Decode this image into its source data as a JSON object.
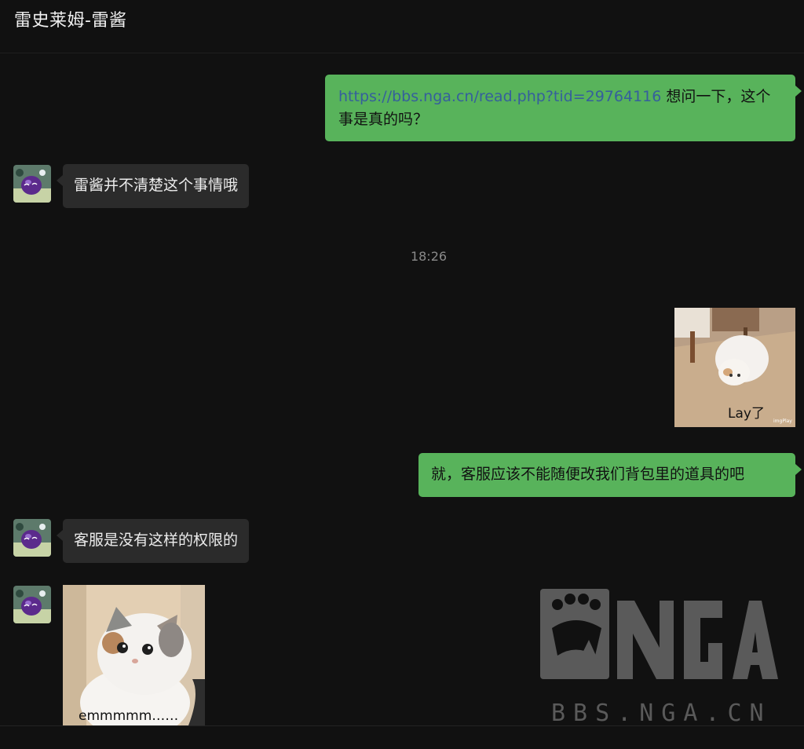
{
  "header": {
    "title": "雷史莱姆-雷酱"
  },
  "messages": {
    "m1": {
      "link": "https://bbs.nga.cn/read.php?tid=29764116",
      "text_line1": " 想问一下，这个",
      "text_line2": "事是真的吗？"
    },
    "m2": {
      "text": "雷酱并不清楚这个事情哦"
    },
    "time": "18:26",
    "m3": {
      "caption": "Lay了",
      "credit": "imgPlay"
    },
    "m4": {
      "text": "就，客服应该不能随便改我们背包里的道具的吧"
    },
    "m5": {
      "text": "客服是没有这样的权限的"
    },
    "m6": {
      "caption": "emmmmm……"
    }
  },
  "watermark": {
    "text": "BBS.NGA.CN"
  },
  "colors": {
    "outgoing_bubble": "#58b35b",
    "incoming_bubble": "#2b2b2b",
    "background": "#111111",
    "link": "#355f9c"
  },
  "icons": {
    "avatar": "purple-slime-avatar-icon",
    "watermark_logo": "bear-paw-icon"
  }
}
